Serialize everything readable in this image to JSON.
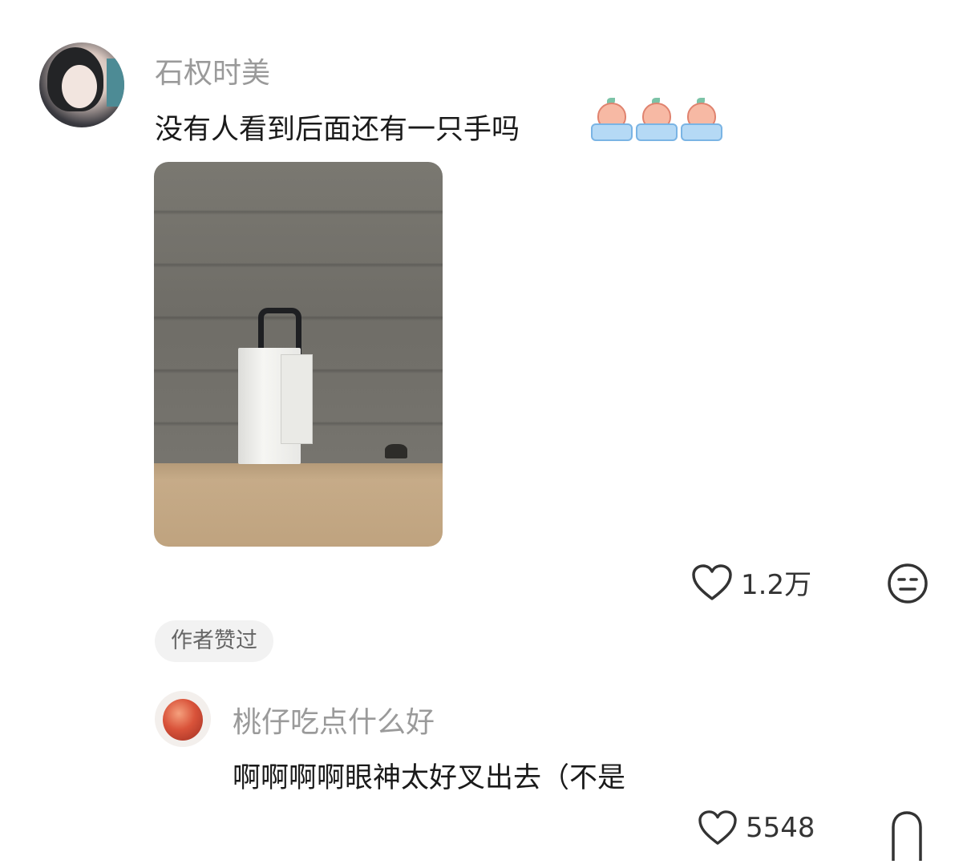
{
  "comment": {
    "username": "石权时美",
    "text": "没有人看到后面还有一只手吗",
    "stickers": [
      "crying-peach-sticker",
      "crying-peach-sticker",
      "crying-peach-sticker"
    ],
    "like_count": "1.2万",
    "author_badge": "作者赞过"
  },
  "reply": {
    "username": "桃仔吃点什么好",
    "text": "啊啊啊啊眼神太好叉出去（不是",
    "like_count": "5548"
  },
  "icons": {
    "like": "heart-outline-icon",
    "reaction": "expressionless-face-icon"
  },
  "colors": {
    "username": "#9a9a9a",
    "text": "#1a1a1a",
    "badge_bg": "#f2f2f2"
  }
}
